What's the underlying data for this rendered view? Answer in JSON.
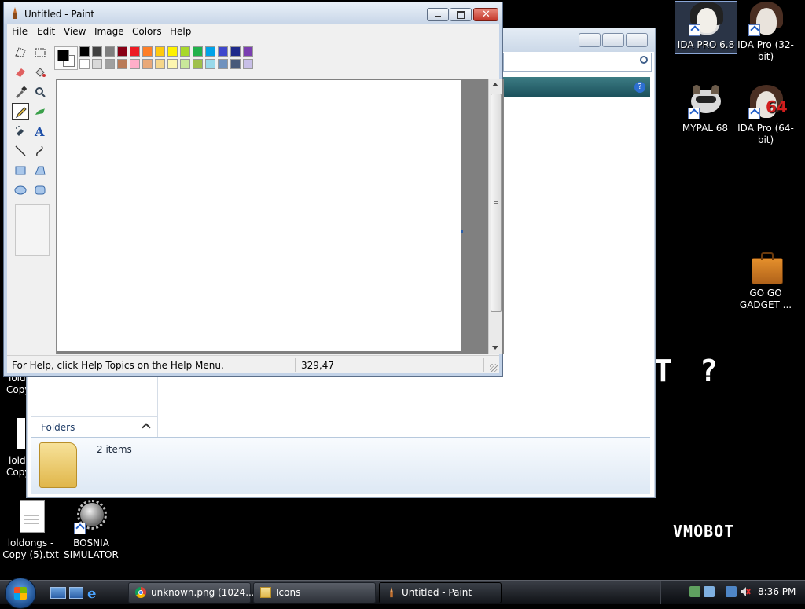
{
  "desktop": {
    "icons": [
      {
        "label": "IDA PRO 6.8"
      },
      {
        "label": "IDA Pro (32-bit)"
      },
      {
        "label": "MYPAL 68"
      },
      {
        "label": "IDA Pro (64-bit)"
      },
      {
        "label": "GO GO GADGET ..."
      },
      {
        "label": "loldongs - Copy (5).txt"
      },
      {
        "label": "BOSNIA SIMULATOR"
      }
    ],
    "partial_labels": [
      "lold",
      "Copy",
      "lold",
      "Copy"
    ],
    "pixel_text_1": "?",
    "pixel_text_2": "VMOBOT",
    "pixel_text_3": "T"
  },
  "explorer": {
    "folders_label": "Folders",
    "item_count": "2 items"
  },
  "paint": {
    "title": "Untitled - Paint",
    "menu": [
      "File",
      "Edit",
      "View",
      "Image",
      "Colors",
      "Help"
    ],
    "status": {
      "help_text": "For Help, click Help Topics on the Help Menu.",
      "coords": "329,47"
    },
    "palette": {
      "primary": "#000000",
      "secondary": "#ffffff",
      "row1": [
        "#000000",
        "#404040",
        "#7f7f7f",
        "#880015",
        "#ed1c24",
        "#ff7f27",
        "#ffc90e",
        "#fff200",
        "#a8d82a",
        "#22b14c",
        "#00a2e8",
        "#3f48cc",
        "#1f2a8a",
        "#7a3fb0"
      ],
      "row2": [
        "#ffffff",
        "#d9d9d9",
        "#a0a0a0",
        "#b97a57",
        "#ffaec9",
        "#e8a878",
        "#f5d68a",
        "#fdf6b0",
        "#c9e89a",
        "#9fc04a",
        "#99d9ea",
        "#7092be",
        "#485a7a",
        "#c8bfe7"
      ]
    }
  },
  "taskbar": {
    "tasks": [
      {
        "label": "unknown.png (1024..."
      },
      {
        "label": "Icons"
      },
      {
        "label": "Untitled - Paint"
      }
    ],
    "clock": "8:36 PM"
  }
}
